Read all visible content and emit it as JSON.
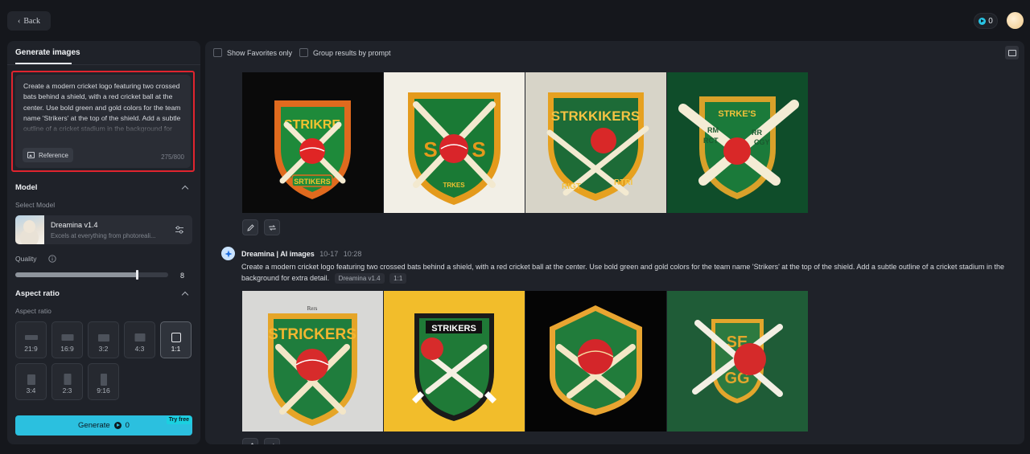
{
  "topbar": {
    "back_label": "Back",
    "credits": "0"
  },
  "left": {
    "tab_label": "Generate images",
    "prompt_text": "Create a modern cricket logo featuring two crossed bats behind a shield, with a red cricket ball at the center. Use bold green and gold colors for the team name 'Strikers' at the top of the shield. Add a subtle outline of a cricket stadium in the background for extra detail.",
    "reference_label": "Reference",
    "char_count": "275/800",
    "model_section": "Model",
    "select_model_label": "Select Model",
    "model_name": "Dreamina v1.4",
    "model_desc": "Excels at everything from photoreali...",
    "quality_label": "Quality",
    "quality_value": "8",
    "quality_max": 10,
    "aspect_section": "Aspect ratio",
    "aspect_sub_label": "Aspect ratio",
    "ratios": [
      "21:9",
      "16:9",
      "3:2",
      "4:3",
      "1:1",
      "3:4",
      "2:3",
      "9:16"
    ],
    "selected_ratio": "1:1",
    "generate_label": "Generate",
    "generate_cost": "0",
    "try_free_label": "Try free"
  },
  "main": {
    "show_favorites_label": "Show Favorites only",
    "group_by_prompt_label": "Group results by prompt",
    "generation": {
      "author": "Dreamina | AI images",
      "date": "10-17",
      "time": "10:28",
      "prompt": "Create a modern cricket logo featuring two crossed bats behind a shield, with a red cricket ball at the center. Use bold green and gold colors for the team name 'Strikers' at the top of the shield. Add a subtle outline of a cricket stadium in the background for extra detail.",
      "model_tag": "Dreamina v1.4",
      "ratio_tag": "1:1"
    },
    "row1_texts": [
      "STRIKRE",
      "SRTIKERS",
      "S",
      "S",
      "TRKES",
      "STRKKIKERS",
      "RIGT",
      "RTRI",
      "STRKE'S",
      "RM",
      "RCT",
      "RR",
      "CGY"
    ],
    "row2_texts": [
      "Rers",
      "STRICKERS",
      "STRIKERS",
      "SE",
      "GG"
    ]
  },
  "colors": {
    "accent": "#2bc0df",
    "highlight_border": "#e0242e",
    "panel": "#1f2229",
    "background": "#15171c"
  }
}
